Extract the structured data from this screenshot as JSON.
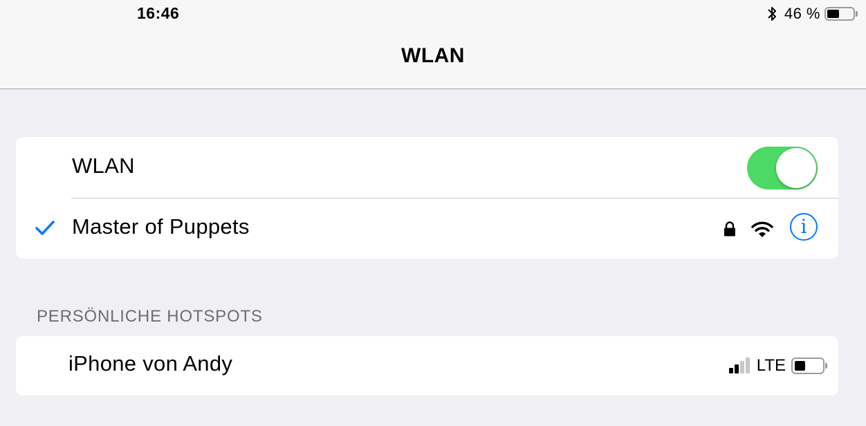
{
  "status_bar": {
    "time": "16:46",
    "battery_percent_text": "46 %",
    "battery_level": 0.46,
    "bluetooth_icon": "bluetooth-icon"
  },
  "nav": {
    "title": "WLAN"
  },
  "wlan_group": {
    "toggle_label": "WLAN",
    "toggle_on": true,
    "connected_network": {
      "name": "Master of Puppets",
      "secured": true,
      "icons": [
        "checkmark-icon",
        "lock-icon",
        "wifi-icon",
        "info-icon"
      ],
      "info_glyph": "i"
    }
  },
  "hotspots": {
    "section_title": "PERSÖNLICHE HOTSPOTS",
    "items": [
      {
        "name": "iPhone von Andy",
        "signal_bars": 2,
        "signal_bars_total": 4,
        "network_type": "LTE",
        "battery_level": 0.4
      }
    ]
  },
  "colors": {
    "accent": "#007aff",
    "toggle_on": "#4cd964",
    "background": "#efeff4",
    "section_header": "#6d6d72"
  }
}
